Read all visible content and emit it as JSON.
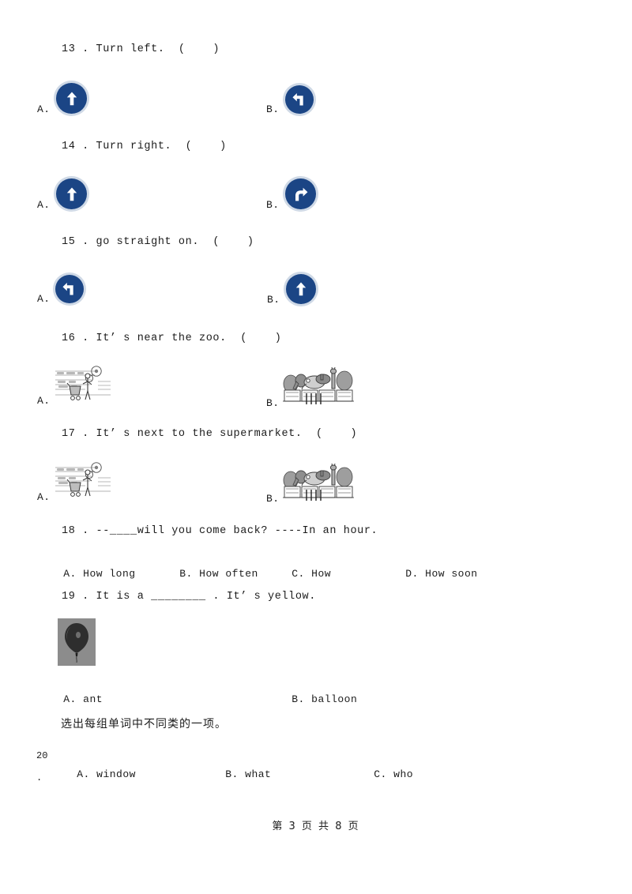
{
  "document": {
    "page_footer": "第 3 页 共 8 页",
    "footer_page_number": "3",
    "footer_total_pages": "8",
    "sign_colors": {
      "ring": "#cfd9e6",
      "disc": "#1b4585",
      "arrow": "#ffffff"
    }
  },
  "questions": [
    {
      "number": "13",
      "stem": "13 . Turn left.  (    )",
      "options": [
        {
          "label": "A.",
          "icon": "arrow-straight-sign-icon"
        },
        {
          "label": "B.",
          "icon": "arrow-left-turn-sign-icon"
        }
      ]
    },
    {
      "number": "14",
      "stem": "14 . Turn right.  (    )",
      "options": [
        {
          "label": "A.",
          "icon": "arrow-straight-sign-icon"
        },
        {
          "label": "B.",
          "icon": "arrow-right-turn-sign-icon"
        }
      ]
    },
    {
      "number": "15",
      "stem": "15 . go straight on.  (    )",
      "options": [
        {
          "label": "A.",
          "icon": "arrow-left-turn-sign-icon"
        },
        {
          "label": "B.",
          "icon": "arrow-straight-sign-icon"
        }
      ]
    },
    {
      "number": "16",
      "stem": "16 . It’ s near the zoo.  (    )",
      "options": [
        {
          "label": "A.",
          "icon": "supermarket-sketch-image"
        },
        {
          "label": "B.",
          "icon": "zoo-sketch-image"
        }
      ]
    },
    {
      "number": "17",
      "stem": "17 . It’ s next to the supermarket.  (    )",
      "options": [
        {
          "label": "A.",
          "icon": "supermarket-sketch-image"
        },
        {
          "label": "B.",
          "icon": "zoo-sketch-image"
        }
      ]
    },
    {
      "number": "18",
      "stem": "18 . --____will you come back? ----In an hour.",
      "options": [
        {
          "label": "A.",
          "text": "How long"
        },
        {
          "label": "B.",
          "text": "How often"
        },
        {
          "label": "C.",
          "text": "How"
        },
        {
          "label": "D.",
          "text": "How soon"
        }
      ]
    },
    {
      "number": "19",
      "stem": "19 . It is a ________ . It’ s yellow.",
      "image": "balloon-photo",
      "options": [
        {
          "label": "A.",
          "text": "ant"
        },
        {
          "label": "B.",
          "text": "balloon"
        }
      ]
    },
    {
      "number": "20",
      "instruction": "选出每组单词中不同类的一项。",
      "margin_number": "20",
      "margin_dot": ".",
      "options": [
        {
          "label": "A.",
          "text": "window"
        },
        {
          "label": "B.",
          "text": "what"
        },
        {
          "label": "C.",
          "text": "who"
        }
      ]
    }
  ]
}
